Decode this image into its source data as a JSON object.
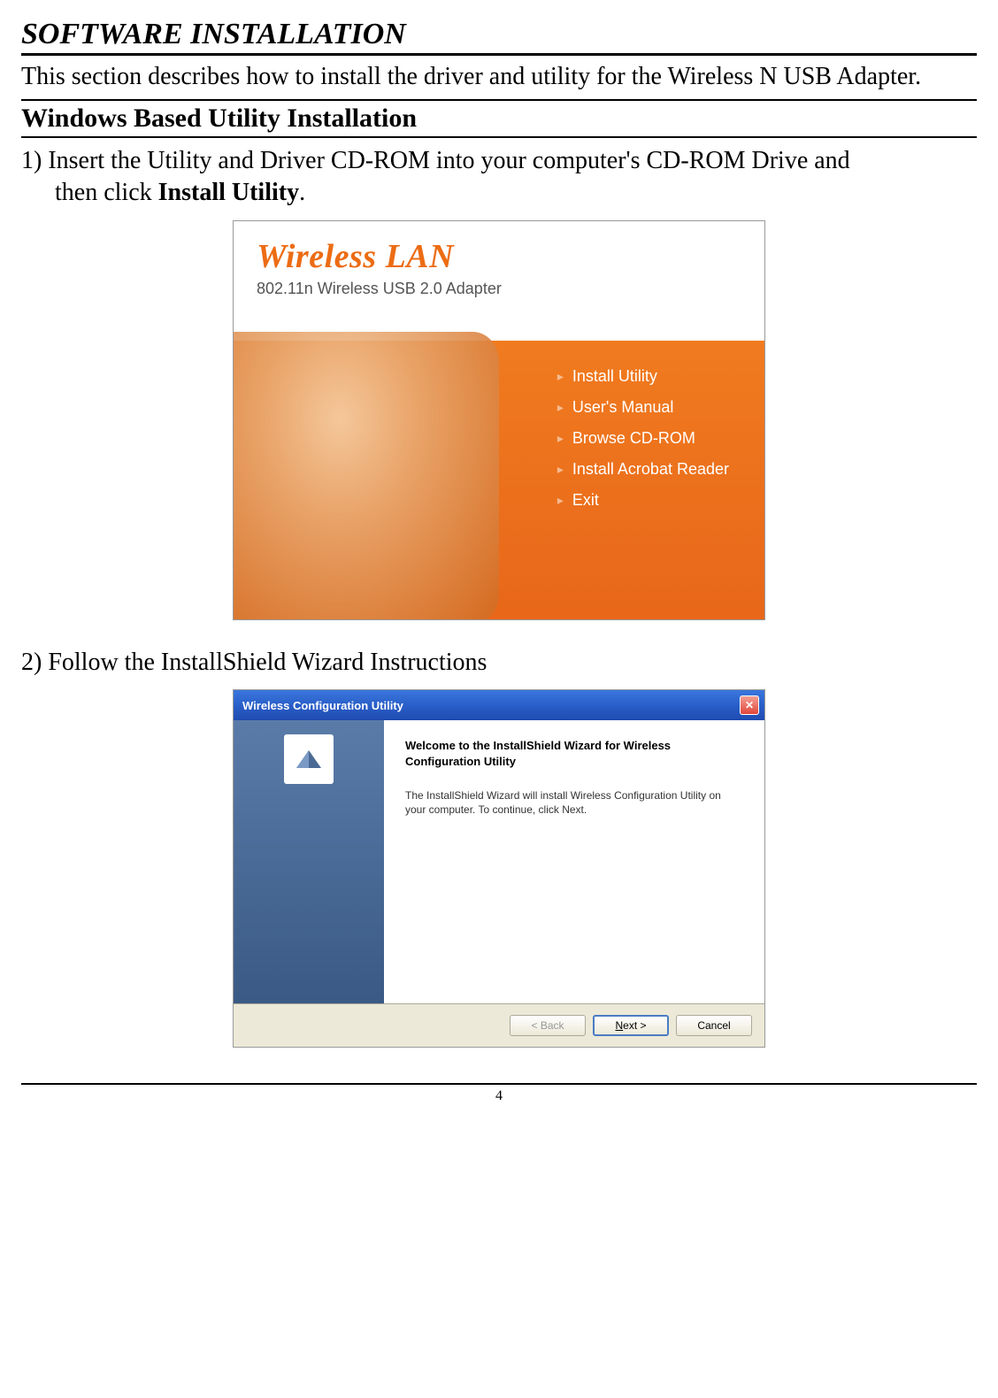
{
  "section_title": "SOFTWARE INSTALLATION",
  "intro": "This section describes how to install the driver and utility for the Wireless N USB Adapter.",
  "subsection_title": "Windows Based Utility Installation",
  "step1_prefix": "1) Insert the Utility and Driver CD-ROM into your computer's CD-ROM Drive and",
  "step1_line2_pre": "then click ",
  "step1_bold": "Install Utility",
  "step1_suffix": ".",
  "autorun": {
    "title": "Wireless LAN",
    "subtitle": "802.11n Wireless USB 2.0 Adapter",
    "menu": [
      "Install Utility",
      "User's Manual",
      "Browse CD-ROM",
      "Install Acrobat Reader",
      "Exit"
    ]
  },
  "step2": "2) Follow the InstallShield Wizard Instructions",
  "installer": {
    "titlebar": "Wireless Configuration Utility",
    "welcome_bold": "Welcome to the InstallShield Wizard for Wireless Configuration Utility",
    "welcome_body": "The InstallShield Wizard will install Wireless Configuration Utility on your computer.  To continue, click Next.",
    "back_label": "< Back",
    "next_prefix": "N",
    "next_suffix": "ext >",
    "cancel_label": "Cancel"
  },
  "page_number": "4"
}
